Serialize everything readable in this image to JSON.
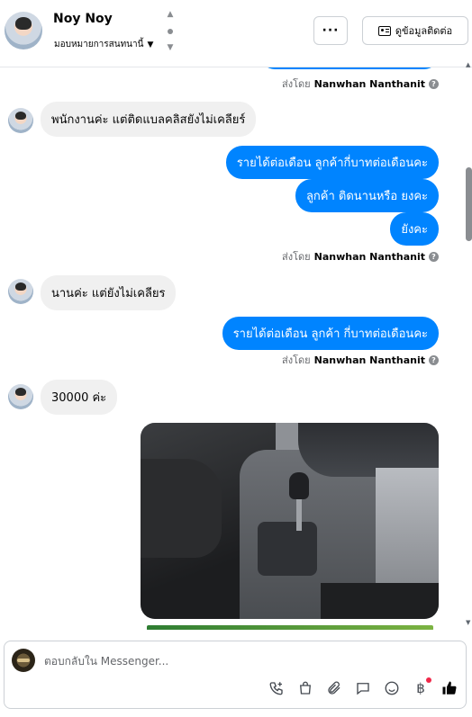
{
  "header": {
    "contact_name": "Noy Noy",
    "assign_label": "มอบหมายการสนทนานี้",
    "more_label": "···",
    "info_button_label": "ดูข้อมูลติดต่อ"
  },
  "messages": {
    "sent_by_prefix": "ส่งโดย",
    "sender_name": "Nanwhan Nanthanit",
    "in_1": "พนักงานค่ะ แต่ติดแบลคลิสยังไม่เคลียร์",
    "out_1": "รายได้ต่อเดือน ลูกค้ากี่บาทต่อเดือนคะ",
    "out_2": "ลูกค้า ติดนานหรือ ยงคะ",
    "out_3": "ยังคะ",
    "in_2": "นานค่ะ แต่ยังไม่เคลียร",
    "out_4": "รายได้ต่อเดือน ลูกค้า กี่บาทต่อเดือนคะ",
    "in_3": "30000 ค่ะ"
  },
  "composer": {
    "placeholder": "ตอบกลับใน Messenger...",
    "tools": [
      "call-add-icon",
      "shop-bag-icon",
      "attach-icon",
      "saved-reply-icon",
      "emoji-icon",
      "baht-payment-icon",
      "like-icon"
    ],
    "baht_symbol": "฿",
    "notification_color": "#f02849"
  },
  "colors": {
    "outgoing_bubble": "#0084ff",
    "incoming_bubble": "#f0f0f0"
  }
}
